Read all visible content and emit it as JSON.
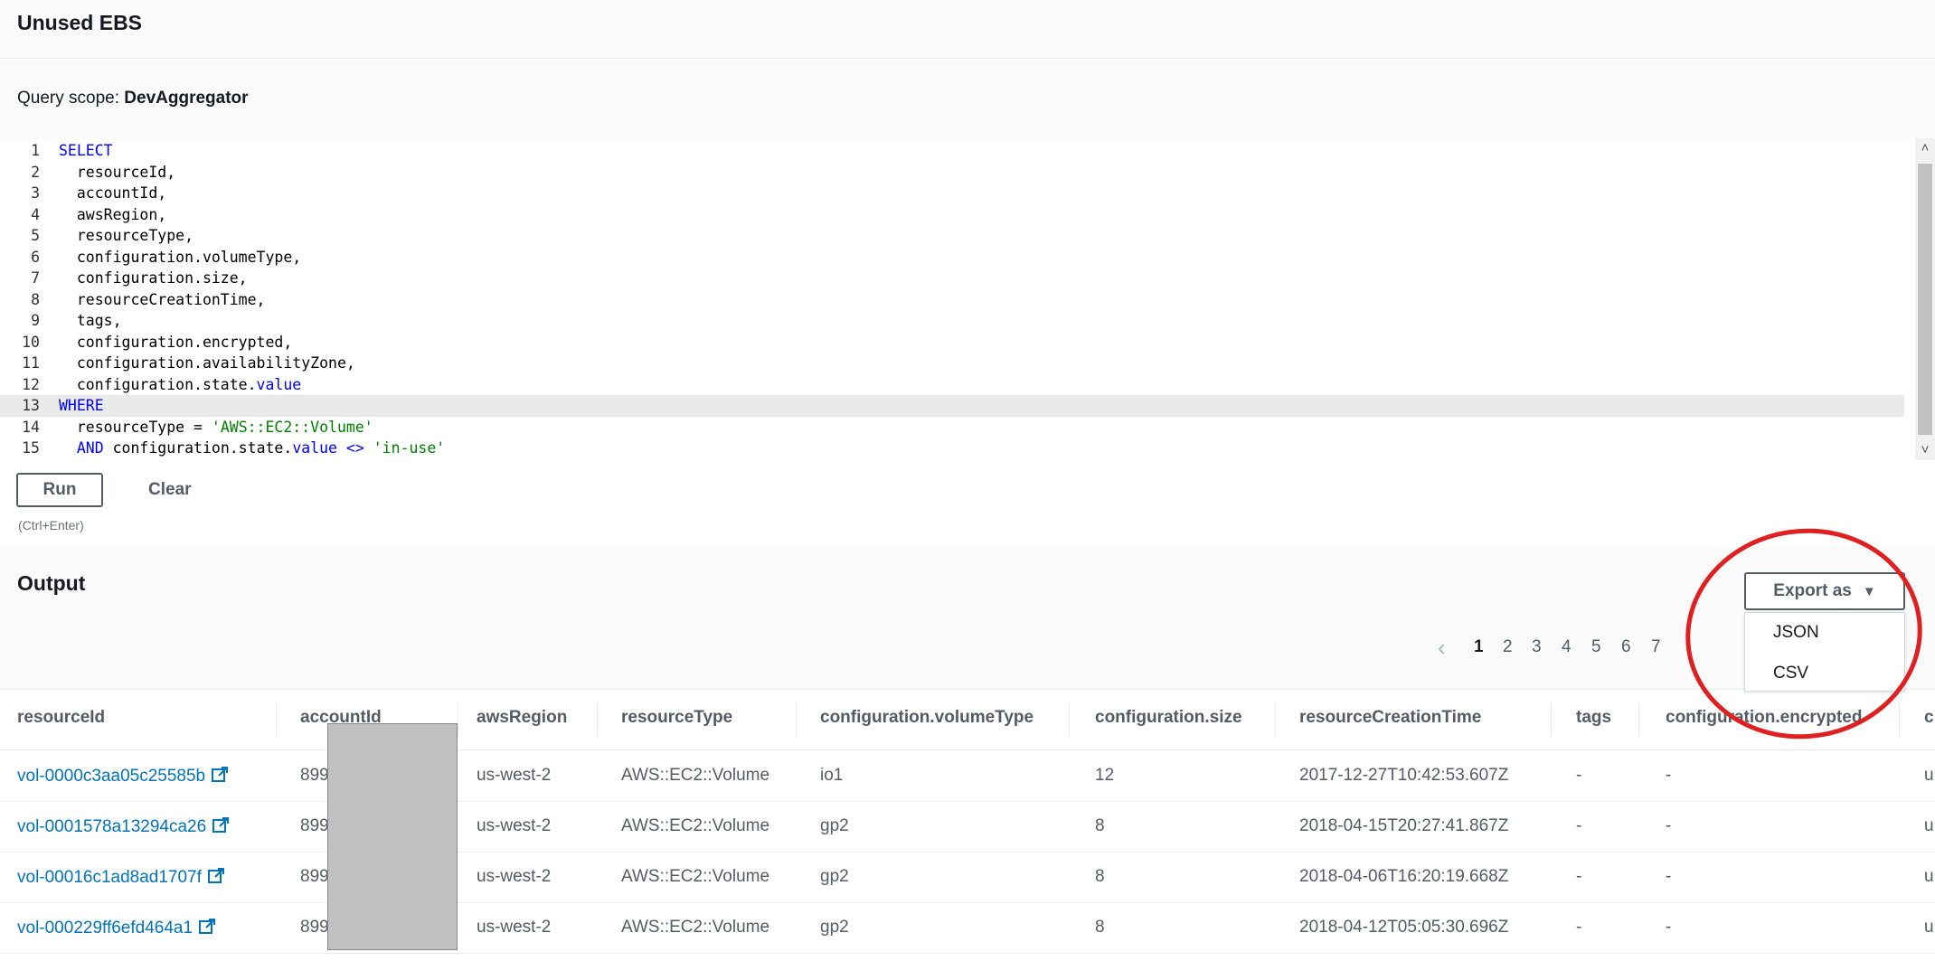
{
  "header": {
    "title": "Unused EBS",
    "query_scope_label": "Query scope:",
    "query_scope_value": "DevAggregator"
  },
  "editor": {
    "active_line": 13,
    "lines": [
      {
        "n": "1",
        "text": "SELECT"
      },
      {
        "n": "2",
        "text": "  resourceId,"
      },
      {
        "n": "3",
        "text": "  accountId,"
      },
      {
        "n": "4",
        "text": "  awsRegion,"
      },
      {
        "n": "5",
        "text": "  resourceType,"
      },
      {
        "n": "6",
        "text": "  configuration.volumeType,"
      },
      {
        "n": "7",
        "text": "  configuration.size,"
      },
      {
        "n": "8",
        "text": "  resourceCreationTime,"
      },
      {
        "n": "9",
        "text": "  tags,"
      },
      {
        "n": "10",
        "text": "  configuration.encrypted,"
      },
      {
        "n": "11",
        "text": "  configuration.availabilityZone,"
      },
      {
        "n": "12",
        "text": "  configuration.state.value"
      },
      {
        "n": "13",
        "text": "WHERE"
      },
      {
        "n": "14",
        "text": "  resourceType = 'AWS::EC2::Volume'"
      },
      {
        "n": "15",
        "text": "  AND configuration.state.value <> 'in-use'"
      }
    ]
  },
  "actions": {
    "run_label": "Run",
    "clear_label": "Clear",
    "shortcut_hint": "(Ctrl+Enter)"
  },
  "output": {
    "title": "Output",
    "export_label": "Export as",
    "export_options": [
      "JSON",
      "CSV"
    ],
    "pagination": {
      "current": "1",
      "pages": [
        "1",
        "2",
        "3",
        "4",
        "5",
        "6",
        "7"
      ]
    }
  },
  "table": {
    "columns": [
      "resourceId",
      "accountId",
      "awsRegion",
      "resourceType",
      "configuration.volumeType",
      "configuration.size",
      "resourceCreationTime",
      "tags",
      "configuration.encrypted",
      "c"
    ],
    "rows": [
      [
        "vol-0000c3aa05c25585b",
        "899",
        "us-west-2",
        "AWS::EC2::Volume",
        "io1",
        "12",
        "2017-12-27T10:42:53.607Z",
        "-",
        "-",
        "u"
      ],
      [
        "vol-0001578a13294ca26",
        "899",
        "us-west-2",
        "AWS::EC2::Volume",
        "gp2",
        "8",
        "2018-04-15T20:27:41.867Z",
        "-",
        "-",
        "u"
      ],
      [
        "vol-00016c1ad8ad1707f",
        "899",
        "us-west-2",
        "AWS::EC2::Volume",
        "gp2",
        "8",
        "2018-04-06T16:20:19.668Z",
        "-",
        "-",
        "u"
      ],
      [
        "vol-000229ff6efd464a1",
        "899",
        "us-west-2",
        "AWS::EC2::Volume",
        "gp2",
        "8",
        "2018-04-12T05:05:30.696Z",
        "-",
        "-",
        "u"
      ]
    ]
  },
  "colors": {
    "link": "#0073bb",
    "keyword": "#0000ff",
    "string": "#008000",
    "annotation": "#e02020"
  }
}
